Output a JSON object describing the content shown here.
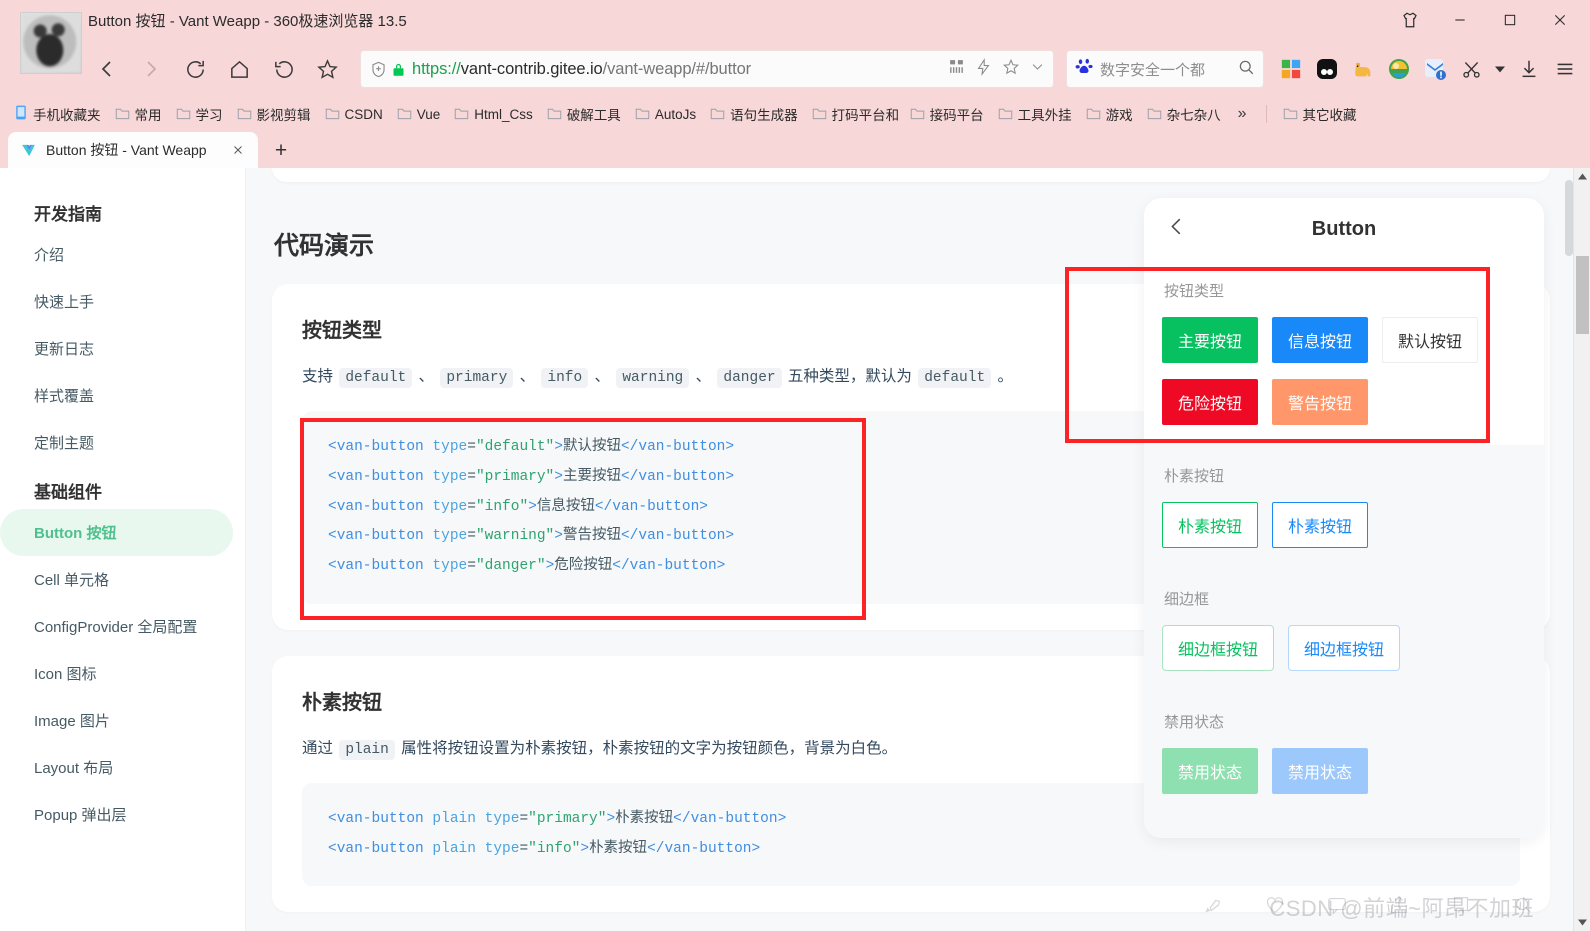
{
  "window": {
    "title": "Button 按钮 - Vant Weapp - 360极速浏览器 13.5",
    "controls": {
      "skin": "skin-icon",
      "minimize": "minimize-icon",
      "maximize": "maximize-icon",
      "close": "close-icon"
    }
  },
  "toolbar": {
    "back": "back-icon",
    "forward": "forward-icon",
    "reload": "reload-icon",
    "home": "home-icon",
    "undo": "undo-icon",
    "favorite": "star-icon"
  },
  "urlbar": {
    "shield": "shield-icon",
    "lock": "lock-icon",
    "scheme": "https://",
    "host": "vant-contrib.gitee.io",
    "path": "/vant-weapp/#/buttor",
    "full_url": "https://vant-contrib.gitee.io/vant-weapp/#/buttor",
    "qrcode_icon": "qrcode-icon",
    "lightning_icon": "lightning-icon",
    "star_icon": "star-icon",
    "chevron_icon": "chevron-down-icon"
  },
  "search": {
    "engine_icon": "baidu-icon",
    "value": "数字安全一个都",
    "placeholder": "数字安全一个都",
    "search_icon": "search-icon"
  },
  "extensions": [
    {
      "name": "windows-grid-icon"
    },
    {
      "name": "panda-icon"
    },
    {
      "name": "cat-icon"
    },
    {
      "name": "rainbow-ball-icon"
    },
    {
      "name": "foxmail-icon"
    },
    {
      "name": "scissors-icon"
    },
    {
      "name": "download-icon"
    },
    {
      "name": "menu-icon"
    }
  ],
  "bookmarks": {
    "items": [
      {
        "label": "手机收藏夹",
        "icon": "phone-bookmark-icon"
      },
      {
        "label": "常用",
        "icon": "folder-icon"
      },
      {
        "label": "学习",
        "icon": "folder-icon"
      },
      {
        "label": "影视剪辑",
        "icon": "folder-icon"
      },
      {
        "label": "CSDN",
        "icon": "folder-icon"
      },
      {
        "label": "Vue",
        "icon": "folder-icon"
      },
      {
        "label": "Html_Css",
        "icon": "folder-icon"
      },
      {
        "label": "破解工具",
        "icon": "folder-icon"
      },
      {
        "label": "AutoJs",
        "icon": "folder-icon"
      },
      {
        "label": "语句生成器",
        "icon": "folder-icon"
      },
      {
        "label": "打码平台和",
        "icon": "folder-icon"
      },
      {
        "label": "接码平台",
        "icon": "folder-icon"
      },
      {
        "label": "工具外挂",
        "icon": "folder-icon"
      },
      {
        "label": "游戏",
        "icon": "folder-icon"
      },
      {
        "label": "杂七杂八",
        "icon": "folder-icon"
      }
    ],
    "overflow": "»",
    "other": {
      "label": "其它收藏",
      "icon": "folder-icon"
    }
  },
  "tabs": {
    "items": [
      {
        "title": "Button 按钮 - Vant Weapp",
        "favicon": "vant-logo-icon",
        "close": "close-icon",
        "active": true
      }
    ],
    "new_tab": "+"
  },
  "sidebar": {
    "groups": [
      {
        "title": "开发指南",
        "items": [
          {
            "label": "介绍",
            "active": false
          },
          {
            "label": "快速上手",
            "active": false
          },
          {
            "label": "更新日志",
            "active": false
          },
          {
            "label": "样式覆盖",
            "active": false
          },
          {
            "label": "定制主题",
            "active": false
          }
        ]
      },
      {
        "title": "基础组件",
        "items": [
          {
            "label": "Button 按钮",
            "active": true
          },
          {
            "label": "Cell 单元格",
            "active": false
          },
          {
            "label": "ConfigProvider 全局配置",
            "active": false
          },
          {
            "label": "Icon 图标",
            "active": false
          },
          {
            "label": "Image 图片",
            "active": false
          },
          {
            "label": "Layout 布局",
            "active": false
          },
          {
            "label": "Popup 弹出层",
            "active": false
          }
        ]
      }
    ]
  },
  "doc": {
    "heading": "代码演示",
    "sections": [
      {
        "title": "按钮类型",
        "desc_parts": [
          {
            "t": "支持 ",
            "code": false
          },
          {
            "t": "default",
            "code": true
          },
          {
            "t": " 、 ",
            "code": false
          },
          {
            "t": "primary",
            "code": true
          },
          {
            "t": " 、 ",
            "code": false
          },
          {
            "t": "info",
            "code": true
          },
          {
            "t": " 、 ",
            "code": false
          },
          {
            "t": "warning",
            "code": true
          },
          {
            "t": " 、 ",
            "code": false
          },
          {
            "t": "danger",
            "code": true
          },
          {
            "t": " 五种类型，默认为 ",
            "code": false
          },
          {
            "t": "default",
            "code": true
          },
          {
            "t": " 。",
            "code": false
          }
        ],
        "code_lines": [
          [
            {
              "c": "tag",
              "t": "<van-button"
            },
            {
              "c": "attr",
              "t": " type"
            },
            {
              "c": "txt",
              "t": "="
            },
            {
              "c": "val",
              "t": "\"default\""
            },
            {
              "c": "tag",
              "t": ">"
            },
            {
              "c": "txt",
              "t": "默认按钮"
            },
            {
              "c": "tag",
              "t": "</van-button>"
            }
          ],
          [
            {
              "c": "tag",
              "t": "<van-button"
            },
            {
              "c": "attr",
              "t": " type"
            },
            {
              "c": "txt",
              "t": "="
            },
            {
              "c": "val",
              "t": "\"primary\""
            },
            {
              "c": "tag",
              "t": ">"
            },
            {
              "c": "txt",
              "t": "主要按钮"
            },
            {
              "c": "tag",
              "t": "</van-button>"
            }
          ],
          [
            {
              "c": "tag",
              "t": "<van-button"
            },
            {
              "c": "attr",
              "t": " type"
            },
            {
              "c": "txt",
              "t": "="
            },
            {
              "c": "val",
              "t": "\"info\""
            },
            {
              "c": "tag",
              "t": ">"
            },
            {
              "c": "txt",
              "t": "信息按钮"
            },
            {
              "c": "tag",
              "t": "</van-button>"
            }
          ],
          [
            {
              "c": "tag",
              "t": "<van-button"
            },
            {
              "c": "attr",
              "t": " type"
            },
            {
              "c": "txt",
              "t": "="
            },
            {
              "c": "val",
              "t": "\"warning\""
            },
            {
              "c": "tag",
              "t": ">"
            },
            {
              "c": "txt",
              "t": "警告按钮"
            },
            {
              "c": "tag",
              "t": "</van-button>"
            }
          ],
          [
            {
              "c": "tag",
              "t": "<van-button"
            },
            {
              "c": "attr",
              "t": " type"
            },
            {
              "c": "txt",
              "t": "="
            },
            {
              "c": "val",
              "t": "\"danger\""
            },
            {
              "c": "tag",
              "t": ">"
            },
            {
              "c": "txt",
              "t": "危险按钮"
            },
            {
              "c": "tag",
              "t": "</van-button>"
            }
          ]
        ],
        "copy_icon": "copy-icon",
        "highlighted": true
      },
      {
        "title": "朴素按钮",
        "desc_parts": [
          {
            "t": "通过 ",
            "code": false
          },
          {
            "t": "plain",
            "code": true
          },
          {
            "t": " 属性将按钮设置为朴素按钮，朴素按钮的文字为按钮颜色，背景为白色。",
            "code": false
          }
        ],
        "code_lines": [
          [
            {
              "c": "tag",
              "t": "<van-button"
            },
            {
              "c": "attr",
              "t": " plain type"
            },
            {
              "c": "txt",
              "t": "="
            },
            {
              "c": "val",
              "t": "\"primary\""
            },
            {
              "c": "tag",
              "t": ">"
            },
            {
              "c": "txt",
              "t": "朴素按钮"
            },
            {
              "c": "tag",
              "t": "</van-button>"
            }
          ],
          [
            {
              "c": "tag",
              "t": "<van-button"
            },
            {
              "c": "attr",
              "t": " plain type"
            },
            {
              "c": "txt",
              "t": "="
            },
            {
              "c": "val",
              "t": "\"info\""
            },
            {
              "c": "tag",
              "t": ">"
            },
            {
              "c": "txt",
              "t": "朴素按钮"
            },
            {
              "c": "tag",
              "t": "</van-button>"
            }
          ]
        ],
        "copy_icon": "copy-icon",
        "highlighted": false
      }
    ]
  },
  "preview": {
    "nav": {
      "back_icon": "chevron-left-icon",
      "title": "Button"
    },
    "blocks": [
      {
        "label": "按钮类型",
        "highlighted": true,
        "rows": [
          [
            {
              "text": "主要按钮",
              "style": "primary"
            },
            {
              "text": "信息按钮",
              "style": "info"
            },
            {
              "text": "默认按钮",
              "style": "default"
            }
          ],
          [
            {
              "text": "危险按钮",
              "style": "danger"
            },
            {
              "text": "警告按钮",
              "style": "warning"
            }
          ]
        ]
      },
      {
        "label": "朴素按钮",
        "highlighted": false,
        "rows": [
          [
            {
              "text": "朴素按钮",
              "style": "plain-primary"
            },
            {
              "text": "朴素按钮",
              "style": "plain-info"
            }
          ]
        ]
      },
      {
        "label": "细边框",
        "highlighted": false,
        "rows": [
          [
            {
              "text": "细边框按钮",
              "style": "hair-primary"
            },
            {
              "text": "细边框按钮",
              "style": "hair-info"
            }
          ]
        ]
      },
      {
        "label": "禁用状态",
        "highlighted": false,
        "rows": [
          [
            {
              "text": "禁用状态",
              "style": "dis-primary"
            },
            {
              "text": "禁用状态",
              "style": "dis-info"
            }
          ]
        ]
      }
    ]
  },
  "watermark": {
    "text": "CSDN @前端~阿昂不加班"
  },
  "colors": {
    "chrome_bg": "#f7d7d7",
    "page_bg": "#f7f8fa",
    "primary_green": "#07c160",
    "info_blue": "#1989fa",
    "danger_red": "#ee0a24",
    "warning_orange": "#ff976a",
    "highlight_red": "#fb2323",
    "sidebar_active": "#4fc08d"
  }
}
